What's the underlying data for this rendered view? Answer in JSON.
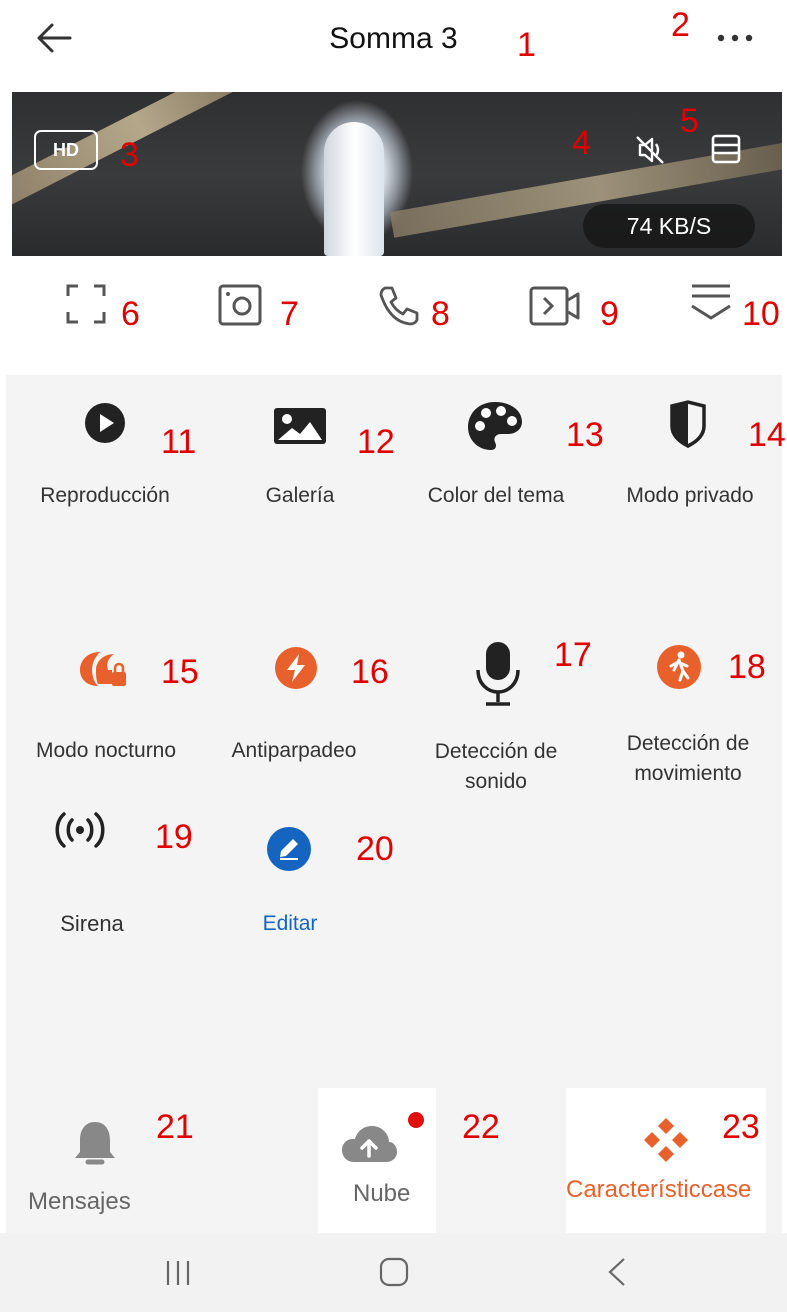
{
  "header": {
    "title": "Somma 3"
  },
  "video": {
    "quality_badge": "HD",
    "speed": "74 KB/S"
  },
  "features": {
    "reproduccion": "Reproducción",
    "galeria": "Galería",
    "color_tema": "Color del tema",
    "modo_privado": "Modo privado",
    "modo_nocturno": "Modo nocturno",
    "antiparpadeo": "Antiparpadeo",
    "deteccion_sonido_1": "Detección de",
    "deteccion_sonido_2": "sonido",
    "deteccion_mov_1": "Detección de",
    "deteccion_mov_2": "movimiento",
    "sirena": "Sirena",
    "editar": "Editar"
  },
  "tabs": {
    "mensajes": "Mensajes",
    "nube": "Nube",
    "caracteristicas": "Característiccase"
  },
  "annotations": {
    "n1": "1",
    "n2": "2",
    "n3": "3",
    "n4": "4",
    "n5": "5",
    "n6": "6",
    "n7": "7",
    "n8": "8",
    "n9": "9",
    "n10": "10",
    "n11": "11",
    "n12": "12",
    "n13": "13",
    "n14": "14",
    "n15": "15",
    "n16": "16",
    "n17": "17",
    "n18": "18",
    "n19": "19",
    "n20": "20",
    "n21": "21",
    "n22": "22",
    "n23": "23"
  },
  "colors": {
    "accent": "#e8602c",
    "edit_blue": "#1565c0",
    "annotation_red": "#e00000",
    "badge_red": "#e01010"
  }
}
